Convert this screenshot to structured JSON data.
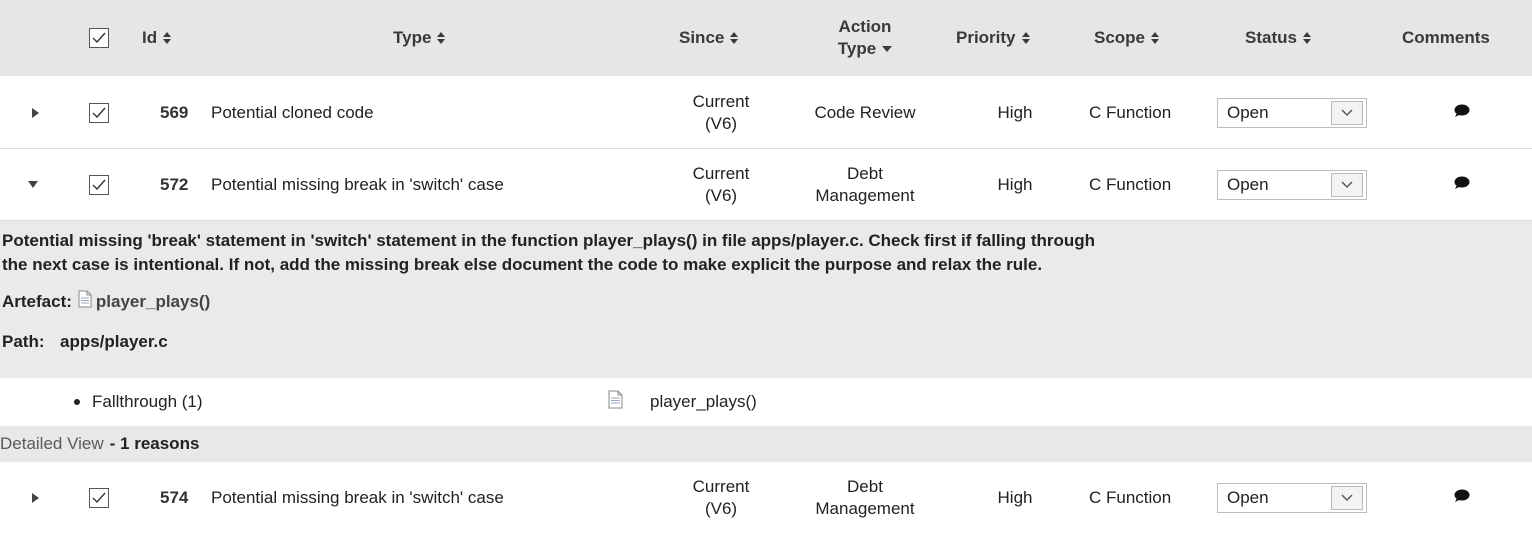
{
  "header": {
    "id_label": "Id",
    "type_label": "Type",
    "since_label": "Since",
    "action_type_label_1": "Action",
    "action_type_label_2": "Type",
    "priority_label": "Priority",
    "scope_label": "Scope",
    "status_label": "Status",
    "comments_label": "Comments"
  },
  "rows": [
    {
      "id": "569",
      "type": "Potential cloned code",
      "since_1": "Current",
      "since_2": "(V6)",
      "action_1": "Code Review",
      "action_2": "",
      "priority": "High",
      "scope": "C Function",
      "status": "Open",
      "expanded": false
    },
    {
      "id": "572",
      "type": "Potential missing break in 'switch' case",
      "since_1": "Current",
      "since_2": "(V6)",
      "action_1": "Debt",
      "action_2": "Management",
      "priority": "High",
      "scope": "C Function",
      "status": "Open",
      "expanded": true
    },
    {
      "id": "574",
      "type": "Potential missing break in 'switch' case",
      "since_1": "Current",
      "since_2": "(V6)",
      "action_1": "Debt",
      "action_2": "Management",
      "priority": "High",
      "scope": "C Function",
      "status": "Open",
      "expanded": false
    }
  ],
  "detail": {
    "description_line1": "Potential missing 'break' statement in 'switch' statement in the function player_plays() in file apps/player.c. Check first if falling through",
    "description_line2": "the next case is intentional. If not, add the missing break else document the code to make explicit the purpose and relax the rule.",
    "artefact_label": "Artefact:",
    "artefact_value": "player_plays()",
    "path_label": "Path:",
    "path_value": "apps/player.c",
    "reason_text": "Fallthrough (1)",
    "reason_artefact": "player_plays()",
    "detailed_view_link": "Detailed View",
    "reasons_count": "- 1 reasons"
  },
  "icons": {
    "checkbox": "checkbox-checked-icon",
    "expand": "triangle-right-icon",
    "collapse": "triangle-down-icon",
    "sort": "sort-updown-icon",
    "sort_desc": "sort-down-icon",
    "comment": "speech-bubble-icon",
    "document": "document-icon"
  }
}
